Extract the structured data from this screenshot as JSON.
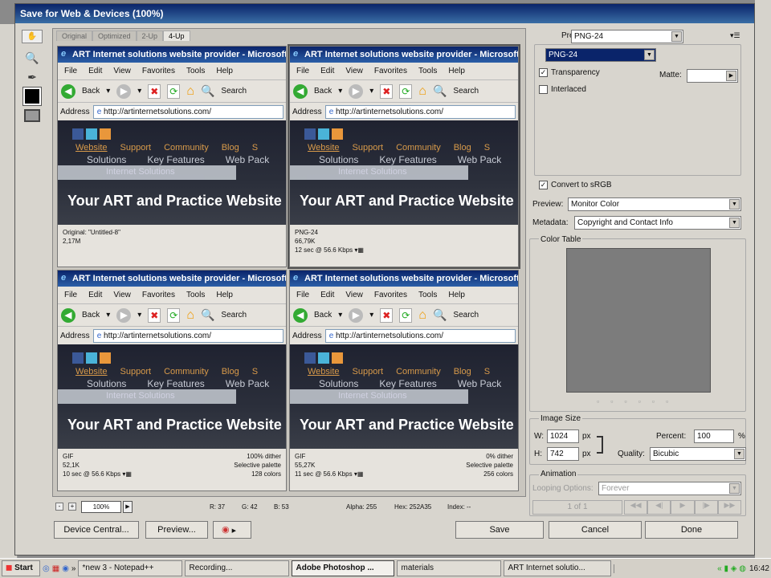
{
  "dialog": {
    "title": "Save for Web & Devices (100%)"
  },
  "tabs": [
    "Original",
    "Optimized",
    "2-Up",
    "4-Up"
  ],
  "browser": {
    "title": "ART Internet solutions website provider - Microsoft Internet Explorer",
    "menu": [
      "File",
      "Edit",
      "View",
      "Favorites",
      "Tools",
      "Help"
    ],
    "back": "Back",
    "search": "Search",
    "address_label": "Address",
    "url": "http://artinternetsolutions.com/"
  },
  "website": {
    "nav": [
      "Website",
      "Support",
      "Community",
      "Blog",
      "S"
    ],
    "sub": [
      "Solutions",
      "Key Features",
      "Web Pack"
    ],
    "bar": "Internet Solutions",
    "hero": "Your ART and Practice Website"
  },
  "panels": [
    {
      "l1": "Original: \"Untitled-8\"",
      "l2": "2,17M",
      "l3": "",
      "r1": "",
      "r2": "",
      "r3": ""
    },
    {
      "l1": "PNG-24",
      "l2": "66,79K",
      "l3": "12 sec @ 56.6 Kbps",
      "r1": "",
      "r2": "",
      "r3": ""
    },
    {
      "l1": "GIF",
      "l2": "52,1K",
      "l3": "10 sec @ 56.6 Kbps",
      "r1": "100% dither",
      "r2": "Selective palette",
      "r3": "128 colors"
    },
    {
      "l1": "GIF",
      "l2": "55,27K",
      "l3": "11 sec @ 56.6 Kbps",
      "r1": "0% dither",
      "r2": "Selective palette",
      "r3": "256 colors"
    }
  ],
  "status": {
    "zoom": "100%",
    "r": "R: 37",
    "g": "G: 42",
    "b": "B: 53",
    "alpha": "Alpha: 255",
    "hex": "Hex: 252A35",
    "index": "Index: --"
  },
  "settings": {
    "preset_label": "Preset:",
    "preset": "PNG-24",
    "format": "PNG-24",
    "transparency": "Transparency",
    "interlaced": "Interlaced",
    "matte_label": "Matte:",
    "convert": "Convert to sRGB",
    "preview_label": "Preview:",
    "preview": "Monitor Color",
    "metadata_label": "Metadata:",
    "metadata": "Copyright and Contact Info",
    "color_table": "Color Table",
    "image_size": "Image Size",
    "w_label": "W:",
    "w": "1024",
    "h_label": "H:",
    "h": "742",
    "px": "px",
    "percent_label": "Percent:",
    "percent": "100",
    "pct": "%",
    "quality_label": "Quality:",
    "quality": "Bicubic",
    "animation": "Animation",
    "looping_label": "Looping Options:",
    "looping": "Forever",
    "frame": "1 of 1"
  },
  "buttons": {
    "device_central": "Device Central...",
    "preview": "Preview...",
    "save": "Save",
    "cancel": "Cancel",
    "done": "Done"
  },
  "taskbar": {
    "start": "Start",
    "items": [
      "*new 3 - Notepad++",
      "Recording...",
      "Adobe Photoshop ...",
      "materials",
      "ART Internet solutio..."
    ],
    "clock": "16:42"
  }
}
